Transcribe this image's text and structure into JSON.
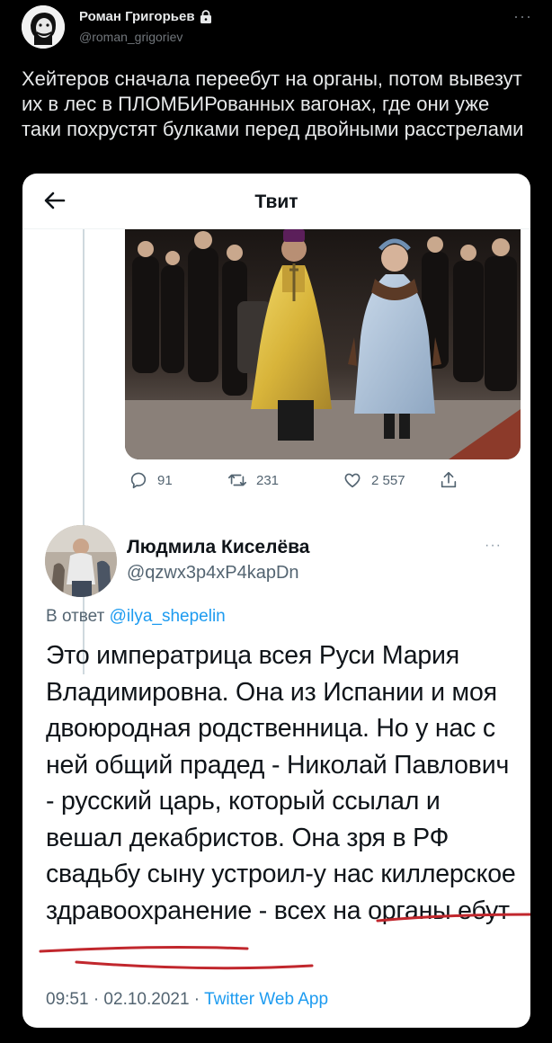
{
  "outer_tweet": {
    "author_name": "Роман Григорьев",
    "author_handle": "@roman_grigoriev",
    "more": "···",
    "text": "Хейтеров сначала переебут на органы, потом вывезут их в лес в ПЛОМБИРованных вагонах, где они уже таки похрустят булками перед двойными расстрелами"
  },
  "embedded_screenshot": {
    "header_title": "Твит",
    "actions": {
      "replies": "91",
      "retweets": "231",
      "likes": "2 557"
    },
    "reply": {
      "author_name": "Людмила Киселёва",
      "author_handle": "@qzwx3p4xP4kapDn",
      "more": "···",
      "reply_prefix": "В ответ",
      "reply_mention": "@ilya_shepelin",
      "text": "Это императрица всея Руси Мария Владимировна. Она из Испании и моя двоюродная родственница. Но у нас с ней общий прадед - Николай Павлович - русский царь, который ссылал и вешал декабристов. Она зря в РФ свадьбу сыну устроил-у нас киллерское здравоохранение - всех на органы ебут",
      "time": "09:51 · 02.10.2021 ·",
      "source": "Twitter Web App"
    }
  },
  "colors": {
    "background": "#000000",
    "accent": "#1d9bf0",
    "underline": "#c1272d"
  }
}
